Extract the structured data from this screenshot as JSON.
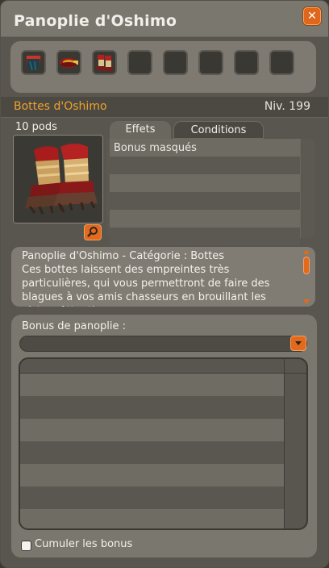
{
  "window": {
    "title": "Panoplie d'Oshimo",
    "close_glyph": "✕"
  },
  "set_slots": [
    {
      "name": "cape-oshimo",
      "filled": true
    },
    {
      "name": "coiffe-oshimo",
      "filled": true
    },
    {
      "name": "bottes-oshimo",
      "filled": true
    },
    {
      "name": "empty",
      "filled": false
    },
    {
      "name": "empty",
      "filled": false
    },
    {
      "name": "empty",
      "filled": false
    },
    {
      "name": "empty",
      "filled": false
    },
    {
      "name": "empty",
      "filled": false
    }
  ],
  "item": {
    "name": "Bottes d'Oshimo",
    "level": "Niv. 199",
    "pods": "10 pods",
    "zoom_icon": "magnifier-icon"
  },
  "tabs": {
    "effects": "Effets",
    "conditions": "Conditions"
  },
  "effects": {
    "first_row": "Bonus masqués"
  },
  "description": {
    "text": "Panoplie d'Oshimo - Catégorie : Bottes\nCes bottes laissent des empreintes très particulières, qui vous permettront de faire des blagues à vos amis chasseurs en brouillant les pistes. Attention,"
  },
  "panoply": {
    "label": "Bonus de panoplie :",
    "select_value": ""
  },
  "checkbox": {
    "label": "Cumuler les bonus",
    "checked": false
  },
  "colors": {
    "accent_orange": "#e36a1d",
    "item_name": "#f0a02a"
  }
}
